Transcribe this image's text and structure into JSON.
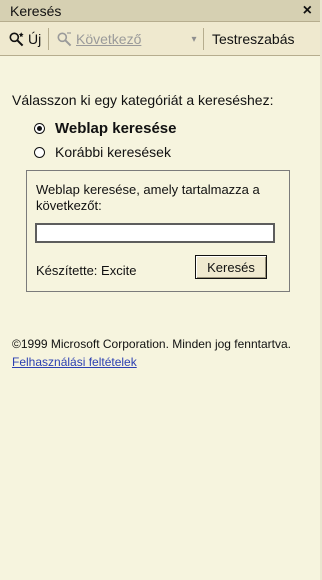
{
  "window": {
    "title": "Keresés",
    "close_glyph": "×"
  },
  "toolbar": {
    "new_label": "Új",
    "next_label": "Következő",
    "customize_label": "Testreszabás"
  },
  "content": {
    "prompt": "Válasszon ki egy kategóriát a kereséshez:",
    "options": [
      {
        "label": "Weblap keresése",
        "selected": true
      },
      {
        "label": "Korábbi keresések",
        "selected": false
      }
    ],
    "search_box": {
      "instruction": "Weblap keresése, amely tartalmazza a következőt:",
      "input_value": "",
      "provider_text": "Készítette: Excite",
      "search_button_label": "Keresés"
    },
    "copyright_text": "©1999 Microsoft Corporation. Minden jog fenntartva.",
    "link_text": "Felhasználási feltételek"
  },
  "colors": {
    "pane_bg": "#f6f4de",
    "toolbar_bg": "#efe9cf",
    "title_bg": "#d6d0b2",
    "link": "#2b3fb2"
  },
  "icons": {
    "new_search_icon": "magnifier-with-star-icon",
    "next_icon": "magnifier-icon",
    "dropdown_icon": "chevron-down-icon",
    "close_icon": "close-icon"
  }
}
